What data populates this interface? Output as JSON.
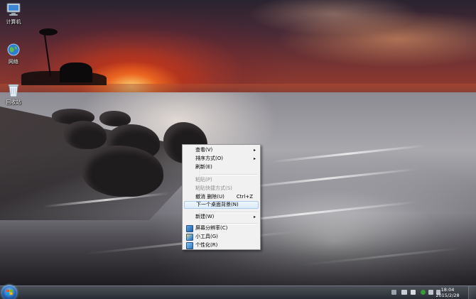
{
  "desktop": {
    "icons": [
      {
        "label": "计算机",
        "icon": "computer-icon"
      },
      {
        "label": "网络",
        "icon": "network-globe-icon"
      },
      {
        "label": "回收站",
        "icon": "recycle-bin-icon"
      }
    ]
  },
  "context_menu": {
    "items": [
      {
        "label": "查看(V)",
        "submenu": true
      },
      {
        "label": "排序方式(O)",
        "submenu": true
      },
      {
        "label": "刷新(E)"
      },
      {
        "label": "粘贴(P)",
        "disabled": true
      },
      {
        "label": "粘贴快捷方式(S)",
        "disabled": true
      },
      {
        "label": "撤消 删除(U)",
        "shortcut": "Ctrl+Z"
      },
      {
        "label": "下一个桌面背景(N)",
        "highlighted": true
      },
      {
        "label": "新建(W)",
        "submenu": true
      },
      {
        "label": "屏幕分辨率(C)",
        "icon": "screen-resolution-icon"
      },
      {
        "label": "小工具(G)",
        "icon": "gadgets-icon"
      },
      {
        "label": "个性化(R)",
        "icon": "personalize-icon"
      }
    ],
    "submenu_arrow": "▸"
  },
  "taskbar": {
    "start_icon": "windows-start-orb-icon",
    "tray_icons": [
      "keyboard-icon",
      "action-center-flag-icon",
      "network-tray-icon",
      "volume-icon",
      "security-shield-icon",
      "language-icon"
    ],
    "clock": {
      "time": "18:04",
      "date": "2015/2/28"
    }
  },
  "colors": {
    "menu_background": "#f1f1f1",
    "menu_highlight": "#dcebfa",
    "menu_highlight_border": "#a8cbef",
    "taskbar": "#2c3038"
  }
}
